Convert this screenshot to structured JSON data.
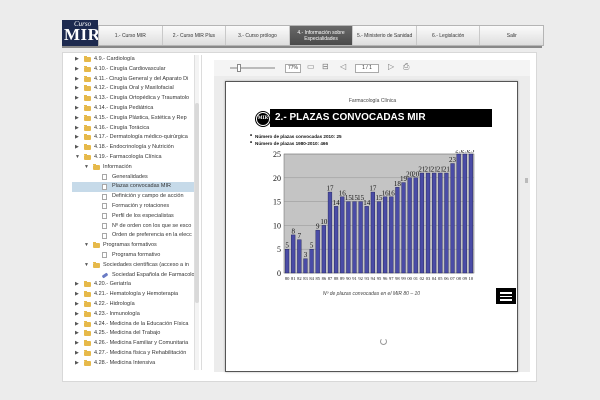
{
  "logo": {
    "small": "Curso",
    "big": "MIR"
  },
  "nav": [
    {
      "label": "1.- Curso MIR",
      "active": false
    },
    {
      "label": "2.- Curso MIR Plus",
      "active": false
    },
    {
      "label": "3.- Curso prólogo",
      "active": false
    },
    {
      "label": "4.- Información sobre Especialidades",
      "active": true
    },
    {
      "label": "5.- Ministerio de Sanidad",
      "active": false
    },
    {
      "label": "6.- Legislación",
      "active": false
    },
    {
      "label": "Salir",
      "active": false
    }
  ],
  "tree": [
    {
      "label": "4.9.- Cardiología",
      "indent": 0,
      "arrow": "▶",
      "icon": "folder"
    },
    {
      "label": "4.10.- Cirugía Cardiovascular",
      "indent": 0,
      "arrow": "▶",
      "icon": "folder"
    },
    {
      "label": "4.11.- Cirugía General y del Aparato Di",
      "indent": 0,
      "arrow": "▶",
      "icon": "folder"
    },
    {
      "label": "4.12.- Cirugía Oral y Maxilofacial",
      "indent": 0,
      "arrow": "▶",
      "icon": "folder"
    },
    {
      "label": "4.13.- Cirugía Ortopédica y Traumatolo",
      "indent": 0,
      "arrow": "▶",
      "icon": "folder"
    },
    {
      "label": "4.14.- Cirugía Pediátrica",
      "indent": 0,
      "arrow": "▶",
      "icon": "folder"
    },
    {
      "label": "4.15.- Cirugía Plástica, Estética y Rep",
      "indent": 0,
      "arrow": "▶",
      "icon": "folder"
    },
    {
      "label": "4.16.- Cirugía Torácica",
      "indent": 0,
      "arrow": "▶",
      "icon": "folder"
    },
    {
      "label": "4.17.- Dermatología médico-quirúrgica",
      "indent": 0,
      "arrow": "▶",
      "icon": "folder"
    },
    {
      "label": "4.18.- Endocrinología y Nutrición",
      "indent": 0,
      "arrow": "▶",
      "icon": "folder"
    },
    {
      "label": "4.19.- Farmacología Clínica",
      "indent": 0,
      "arrow": "▼",
      "icon": "folder"
    },
    {
      "label": "Información",
      "indent": 1,
      "arrow": "▼",
      "icon": "folder"
    },
    {
      "label": "Generalidades",
      "indent": 2,
      "arrow": "",
      "icon": "doc"
    },
    {
      "label": "Plazas convocadas MIR",
      "indent": 2,
      "arrow": "",
      "icon": "doc",
      "selected": true
    },
    {
      "label": "Definición y campo de acción",
      "indent": 2,
      "arrow": "",
      "icon": "doc"
    },
    {
      "label": "Formación y rotaciones",
      "indent": 2,
      "arrow": "",
      "icon": "doc"
    },
    {
      "label": "Perfil de los especialistas",
      "indent": 2,
      "arrow": "",
      "icon": "doc"
    },
    {
      "label": "Nº de orden con los que se esco",
      "indent": 2,
      "arrow": "",
      "icon": "doc"
    },
    {
      "label": "Orden de preferencia en la elecc",
      "indent": 2,
      "arrow": "",
      "icon": "doc"
    },
    {
      "label": "Programas formativos",
      "indent": 1,
      "arrow": "▼",
      "icon": "folder"
    },
    {
      "label": "Programa formativo",
      "indent": 2,
      "arrow": "",
      "icon": "doc"
    },
    {
      "label": "Sociedades científicas (acceso a in",
      "indent": 1,
      "arrow": "▼",
      "icon": "folder"
    },
    {
      "label": "Sociedad Española de Farmacolog",
      "indent": 2,
      "arrow": "",
      "icon": "link"
    },
    {
      "label": "4.20.- Geriatría",
      "indent": 0,
      "arrow": "▶",
      "icon": "folder"
    },
    {
      "label": "4.21.- Hematología y Hemoterapia",
      "indent": 0,
      "arrow": "▶",
      "icon": "folder"
    },
    {
      "label": "4.22.- Hidrología",
      "indent": 0,
      "arrow": "▶",
      "icon": "folder"
    },
    {
      "label": "4.23.- Inmunología",
      "indent": 0,
      "arrow": "▶",
      "icon": "folder"
    },
    {
      "label": "4.24.- Medicina de la Educación Física",
      "indent": 0,
      "arrow": "▶",
      "icon": "folder"
    },
    {
      "label": "4.25.- Medicina del Trabajo",
      "indent": 0,
      "arrow": "▶",
      "icon": "folder"
    },
    {
      "label": "4.26.- Medicina Familiar y Comunitaria",
      "indent": 0,
      "arrow": "▶",
      "icon": "folder"
    },
    {
      "label": "4.27.- Medicina física y Rehabilitación",
      "indent": 0,
      "arrow": "▶",
      "icon": "folder"
    },
    {
      "label": "4.28.- Medicina Intensiva",
      "indent": 0,
      "arrow": "▶",
      "icon": "folder"
    }
  ],
  "viewer": {
    "zoom": "77%",
    "page_indicator": "1 / 1",
    "page_header": "Farmacología Clínica",
    "section_logo": "MIR",
    "section_title": "2.- PLAZAS CONVOCADAS MIR",
    "bullets": [
      "Número de plazas convocadas 2010: 25",
      "Número de plazas 1980-2010: 466"
    ],
    "caption": "Nº de plazas convocadas en el MIR 80 – 10"
  },
  "colors": {
    "bar": "#4a4ca6",
    "plot_bg": "#c4c4c4",
    "active_tab": "#555555"
  },
  "chart_data": {
    "type": "bar",
    "categories": [
      "80",
      "81",
      "82",
      "83",
      "84",
      "85",
      "86",
      "87",
      "88",
      "89",
      "90",
      "91",
      "92",
      "93",
      "94",
      "95",
      "96",
      "97",
      "98",
      "99",
      "00",
      "01",
      "02",
      "03",
      "04",
      "05",
      "06",
      "07",
      "08",
      "09",
      "10"
    ],
    "values": [
      5,
      8,
      7,
      3,
      5,
      9,
      10,
      17,
      14,
      16,
      15,
      15,
      15,
      14,
      17,
      15,
      16,
      16,
      18,
      19,
      20,
      20,
      21,
      21,
      21,
      21,
      21,
      23,
      25,
      25,
      25
    ],
    "value_labels": [
      "5",
      "8",
      "7",
      "3",
      "5",
      "9",
      "10",
      "17",
      "14",
      "16",
      "15",
      "15",
      "15",
      "14",
      "17",
      "15",
      "16",
      "16",
      "18",
      "19",
      "20",
      "20",
      "21",
      "21",
      "21",
      "21",
      "21",
      "23",
      "25",
      "25",
      "25"
    ],
    "title": "",
    "xlabel": "",
    "ylabel": "",
    "ylim": [
      0,
      25
    ],
    "yticks": [
      0,
      5,
      10,
      15,
      20,
      25
    ],
    "grid": true
  }
}
